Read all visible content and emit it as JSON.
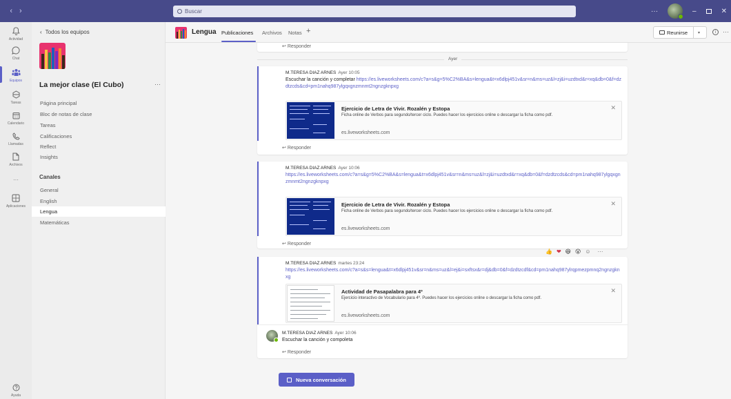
{
  "titlebar": {
    "search_placeholder": "Buscar",
    "nav_back": "‹",
    "nav_forward": "›",
    "more": "···",
    "minimize": "–",
    "close": "✕"
  },
  "rail": {
    "items": [
      {
        "label": "Actividad",
        "icon": "bell-icon"
      },
      {
        "label": "Chat",
        "icon": "chat-icon"
      },
      {
        "label": "Equipos",
        "icon": "teams-icon"
      },
      {
        "label": "Tareas",
        "icon": "assignments-icon"
      },
      {
        "label": "Calendario",
        "icon": "calendar-icon"
      },
      {
        "label": "Llamadas",
        "icon": "phone-icon"
      },
      {
        "label": "Archivos",
        "icon": "file-icon"
      },
      {
        "label": "···",
        "icon": "more-icon"
      },
      {
        "label": "Aplicaciones",
        "icon": "apps-icon"
      },
      {
        "label": "Ayuda",
        "icon": "help-icon"
      }
    ]
  },
  "sidebar": {
    "back_label": "Todos los equipos",
    "team_name": "La mejor clase (El Cubo)",
    "more": "···",
    "tabs": [
      "Página principal",
      "Bloc de notas de clase",
      "Tareas",
      "Calificaciones",
      "Reflect",
      "Insights"
    ],
    "channels_heading": "Canales",
    "channels": [
      "General",
      "English",
      "Lengua",
      "Matemáticas"
    ],
    "active_channel": "Lengua"
  },
  "header": {
    "channel": "Lengua",
    "tabs": [
      "Publicaciones",
      "Archivos",
      "Notas"
    ],
    "add_tab": "+",
    "meet_label": "Reunirse",
    "info": "i",
    "more": "···"
  },
  "conversation": {
    "reply_label": "Responder",
    "day_separator": "Ayer",
    "posts": [
      {
        "author": "M.TERESA DIAZ ARNES",
        "time": "Ayer 10:05",
        "text": "Escuchar la canción y completar ",
        "link": "https://es.liveworksheets.com/c?a=s&g=5%C2%BA&s=lengua&t=x6dlpj451v&sr=n&ms=uz&l=zj&i=uzdtxd&r=xq&db=0&f=dzdtzcds&cd=pm1nahq987ylgqxgnzmnmt2ngnzgknpxg",
        "preview": {
          "title": "Ejercicio de Letra de Vivir. Rozalén y Estopa",
          "desc": "Ficha online de Verbos para segundo/tercer ciclo. Puedes hacer los ejercicios online o descargar la ficha como pdf.",
          "url": "es.liveworksheets.com"
        }
      },
      {
        "author": "M.TERESA DIAZ ARNES",
        "time": "Ayer 10:06",
        "text": "",
        "link": "https://es.liveworksheets.com/c?a=s&g=5%C2%BA&s=lengua&t=x6dlpj451v&sr=n&ms=uz&l=zj&i=uzdtxd&r=xq&db=0&f=dzdtzcds&cd=pm1nahq987ylgqxgnzmnmt2ngnzgknpxg",
        "preview": {
          "title": "Ejercicio de Letra de Vivir. Rozalén y Estopa",
          "desc": "Ficha online de Verbos para segundo/tercer ciclo. Puedes hacer los ejercicios online o descargar la ficha como pdf.",
          "url": "es.liveworksheets.com"
        }
      },
      {
        "author": "M.TERESA DIAZ ARNES",
        "time": "martes 23:24",
        "text": "",
        "link": "https://es.liveworksheets.com/c?a=s&s=lengua&t=x6dlpj451v&sr=n&ms=uz&l=ej&i=sxftsx&r=dj&db=0&f=dzdtzcdf&cd=pm1nahq987ylrqpmezpmnq2ngnzgknxg",
        "preview": {
          "title": "Actividad de Pasapalabra para 4º",
          "desc": "Ejercicio interactivo de Vocabulario para 4º. Puedes hacer los ejercicios online o descargar la ficha como pdf.",
          "url": "es.liveworksheets.com"
        },
        "reply": {
          "author": "M.TERESA DIAZ ARNES",
          "time": "Ayer 10:06",
          "text": "Escuchar la canción y compoleta"
        }
      }
    ],
    "reactions": [
      "👍",
      "❤",
      "😆",
      "😮",
      "☺"
    ],
    "reactions_more": "···"
  },
  "new_conversation_label": "Nueva conversación",
  "colors": {
    "titlebar": "#474a8a",
    "accent": "#5b5fc7",
    "presence": "#6bb700",
    "team_logo": "#e8336e"
  }
}
